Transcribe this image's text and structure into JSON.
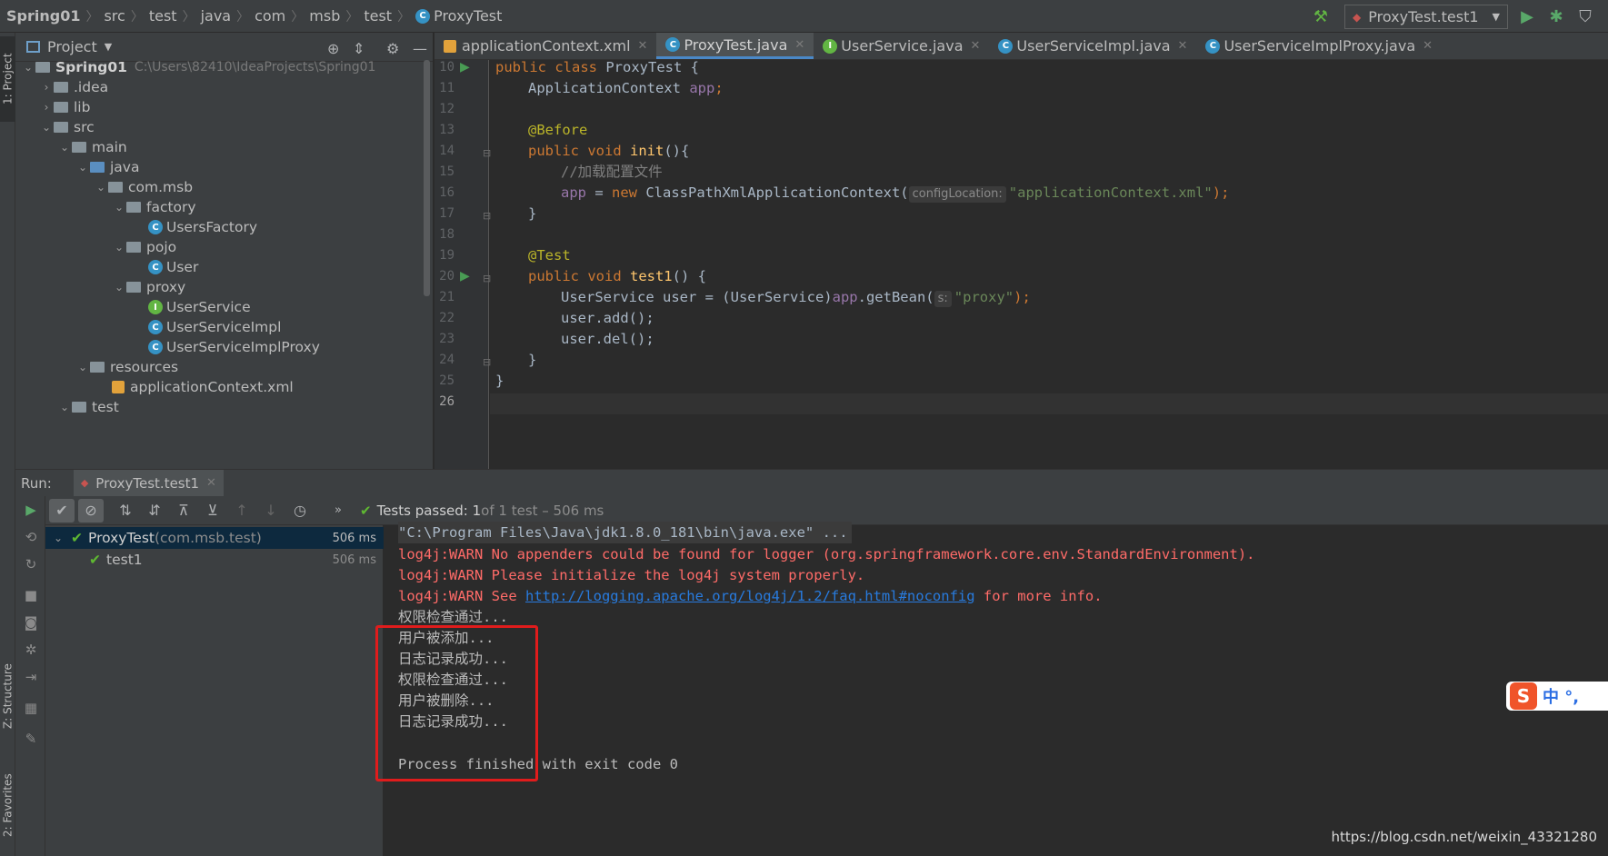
{
  "breadcrumb": [
    "Spring01",
    "src",
    "test",
    "java",
    "com",
    "msb",
    "test",
    "ProxyTest"
  ],
  "run_config": "ProxyTest.test1",
  "left_stripe": {
    "project": "1: Project",
    "structure": "Z: Structure",
    "favorites": "2: Favorites"
  },
  "project_panel": {
    "title": "Project",
    "root_name": "Spring01",
    "root_path": "C:\\Users\\82410\\IdeaProjects\\Spring01",
    "items": [
      {
        "label": ".idea",
        "type": "folder"
      },
      {
        "label": "lib",
        "type": "folder"
      },
      {
        "label": "src",
        "type": "folder"
      },
      {
        "label": "main",
        "type": "folder"
      },
      {
        "label": "java",
        "type": "source-folder"
      },
      {
        "label": "com.msb",
        "type": "package"
      },
      {
        "label": "factory",
        "type": "package"
      },
      {
        "label": "UsersFactory",
        "type": "class"
      },
      {
        "label": "pojo",
        "type": "package"
      },
      {
        "label": "User",
        "type": "class"
      },
      {
        "label": "proxy",
        "type": "package"
      },
      {
        "label": "UserService",
        "type": "interface"
      },
      {
        "label": "UserServiceImpl",
        "type": "class"
      },
      {
        "label": "UserServiceImplProxy",
        "type": "class"
      },
      {
        "label": "resources",
        "type": "resources"
      },
      {
        "label": "applicationContext.xml",
        "type": "xml"
      },
      {
        "label": "test",
        "type": "folder"
      }
    ]
  },
  "tabs": [
    {
      "label": "applicationContext.xml",
      "icon": "xml-icon"
    },
    {
      "label": "ProxyTest.java",
      "icon": "class-icon",
      "active": true
    },
    {
      "label": "UserService.java",
      "icon": "interface-icon"
    },
    {
      "label": "UserServiceImpl.java",
      "icon": "class-icon"
    },
    {
      "label": "UserServiceImplProxy.java",
      "icon": "class-icon"
    }
  ],
  "editor": {
    "line_numbers": [
      "10",
      "11",
      "12",
      "13",
      "14",
      "15",
      "16",
      "17",
      "18",
      "19",
      "20",
      "21",
      "22",
      "23",
      "24",
      "25",
      "26"
    ],
    "code": {
      "l10_kw": "public class ",
      "l10_rest": "ProxyTest {",
      "l11_type": "ApplicationContext ",
      "l11_fld": "app",
      "l11_end": ";",
      "l13_ann": "@Before",
      "l14_kw": "public void ",
      "l14_fn": "init",
      "l14_end": "(){",
      "l15_cmt": "//加载配置文件",
      "l16_fld": "app",
      "l16_eq": " = ",
      "l16_new": "new ",
      "l16_cls": "ClassPathXmlApplicationContext(",
      "l16_hint": "configLocation:",
      "l16_str": "\"applicationContext.xml\"",
      "l16_end": ");",
      "l17": "}",
      "l19_ann": "@Test",
      "l20_kw": "public void ",
      "l20_fn": "test1",
      "l20_end": "() {",
      "l21_a": "UserService user = (UserService)",
      "l21_fld": "app",
      "l21_b": ".getBean(",
      "l21_hint": "s:",
      "l21_str": "\"proxy\"",
      "l21_end": ");",
      "l22": "user.add();",
      "l23": "user.del();",
      "l24": "}",
      "l25": "}"
    }
  },
  "run_panel": {
    "label": "Run:",
    "tab": "ProxyTest.test1",
    "status_bold": "Tests passed: 1",
    "status_rest": " of 1 test – 506 ms",
    "tree": [
      {
        "name": "ProxyTest",
        "pkg": " (com.msb.test)",
        "time": "506 ms"
      },
      {
        "name": "test1",
        "time": "506 ms"
      }
    ],
    "console": {
      "cmd": "\"C:\\Program Files\\Java\\jdk1.8.0_181\\bin\\java.exe\" ...",
      "warn1": "log4j:WARN No appenders could be found for logger (org.springframework.core.env.StandardEnvironment).",
      "warn2": "log4j:WARN Please initialize the log4j system properly.",
      "warn3_a": "log4j:WARN See ",
      "warn3_link": "http://logging.apache.org/log4j/1.2/faq.html#noconfig",
      "warn3_b": " for more info.",
      "out": [
        "权限检查通过...",
        "用户被添加...",
        "日志记录成功...",
        "权限检查通过...",
        "用户被删除...",
        "日志记录成功..."
      ],
      "exit": "Process finished with exit code 0"
    }
  },
  "ime": {
    "logo": "S",
    "text": "中 °,"
  },
  "watermark": "https://blog.csdn.net/weixin_43321280"
}
